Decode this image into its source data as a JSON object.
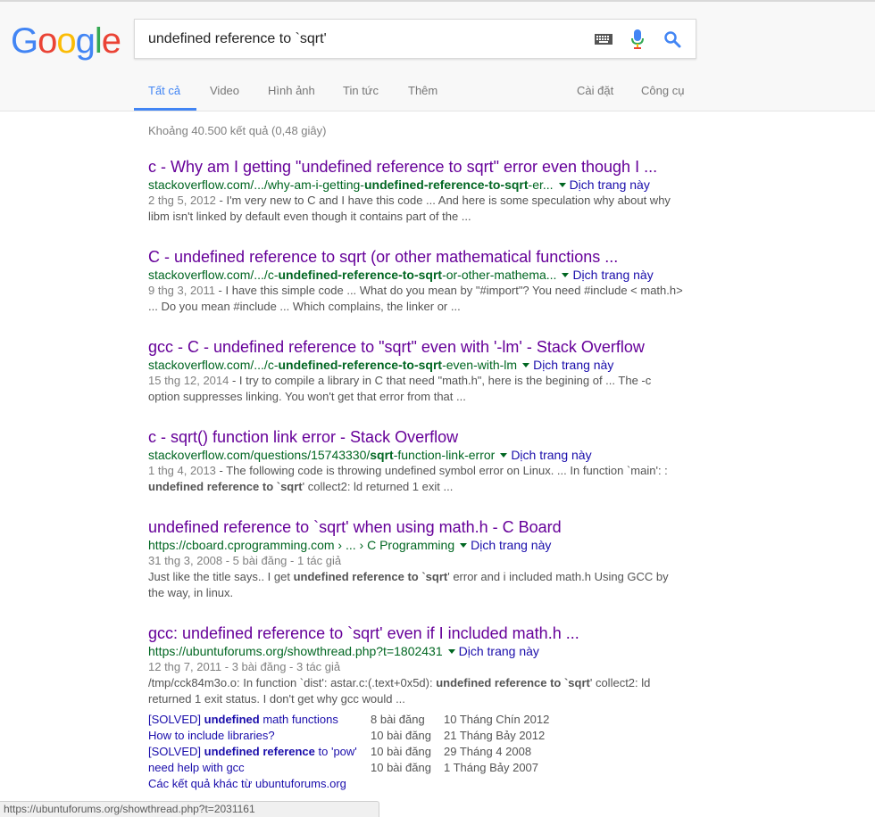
{
  "search": {
    "query": "undefined reference to `sqrt'"
  },
  "logo": {
    "letters": [
      "G",
      "o",
      "o",
      "g",
      "l",
      "e"
    ],
    "colors": [
      "#4285f4",
      "#ea4335",
      "#fbbc05",
      "#4285f4",
      "#34a853",
      "#ea4335"
    ]
  },
  "tabs": {
    "all": "Tất cả",
    "video": "Video",
    "images": "Hình ảnh",
    "news": "Tin tức",
    "more": "Thêm",
    "settings": "Cài đặt",
    "tools": "Công cụ"
  },
  "stats": "Khoảng 40.500 kết quả (0,48 giây)",
  "results": [
    {
      "title": "c - Why am I getting \"undefined reference to sqrt\" error even though I ...",
      "url_pre": "stackoverflow.com/.../why-am-i-getting-",
      "url_bold": "undefined-reference-to-sqrt",
      "url_post": "-er...",
      "translate": "Dịch trang này",
      "date": "2 thg 5, 2012",
      "snippet": " - I'm very new to C and I have this code ... And here is some speculation why about why libm isn't linked by default even though it contains part of the ..."
    },
    {
      "title": "C - undefined reference to sqrt (or other mathematical functions ...",
      "url_pre": "stackoverflow.com/.../c-",
      "url_bold": "undefined-reference-to-sqrt",
      "url_post": "-or-other-mathema...",
      "translate": "Dịch trang này",
      "date": "9 thg 3, 2011",
      "snippet": " - I have this simple code ... What do you mean by \"#import\"? You need #include < math.h> ... Do you mean #include ... Which complains, the linker or ..."
    },
    {
      "title": "gcc - C - undefined reference to \"sqrt\" even with '-lm' - Stack Overflow",
      "url_pre": "stackoverflow.com/.../c-",
      "url_bold": "undefined-reference-to-sqrt",
      "url_post": "-even-with-lm",
      "translate": "Dịch trang này",
      "date": "15 thg 12, 2014",
      "snippet": " - I try to compile a library in C that need \"math.h\", here is the begining of ... The -c option suppresses linking. You won't get that error from that ..."
    },
    {
      "title": "c - sqrt() function link error - Stack Overflow",
      "url_pre": "stackoverflow.com/questions/15743330/",
      "url_bold": "sqrt",
      "url_post": "-function-link-error",
      "translate": "Dịch trang này",
      "date": "1 thg 4, 2013",
      "snippet_pre": " - The following code is throwing undefined symbol error on Linux. ... In function `main': : ",
      "snippet_bold": "undefined reference to `sqrt",
      "snippet_post": "' collect2: ld returned 1 exit ..."
    },
    {
      "title": "undefined reference to `sqrt' when using math.h - C Board",
      "url_pre": "https://cboard.cprogramming.com › ... › C Programming",
      "translate": "Dịch trang này",
      "meta": "31 thg 3, 2008 - 5 bài đăng - 1 tác giả",
      "snippet_pre": "Just like the title says.. I get ",
      "snippet_bold": "undefined reference to `sqrt",
      "snippet_post": "' error and i included math.h Using GCC by the way, in linux."
    },
    {
      "title": "gcc: undefined reference to `sqrt' even if I included math.h ...",
      "url_pre": "https://ubuntuforums.org/showthread.php?t=1802431",
      "translate": "Dịch trang này",
      "meta": "12 thg 7, 2011 - 3 bài đăng - 3 tác giả",
      "snippet_pre": "/tmp/cck84m3o.o: In function `dist': astar.c:(.text+0x5d): ",
      "snippet_bold": "undefined reference to `sqrt",
      "snippet_post": "' collect2: ld returned 1 exit status. I don't get why gcc would ..."
    }
  ],
  "sitelinks": [
    {
      "pre": "[SOLVED] ",
      "bold": "undefined",
      "post": " math functions",
      "posts": "8 bài đăng",
      "date": "10 Tháng Chín 2012"
    },
    {
      "pre": "How to include libraries?",
      "bold": "",
      "post": "",
      "posts": "10 bài đăng",
      "date": "21 Tháng Bảy 2012"
    },
    {
      "pre": "[SOLVED] ",
      "bold": "undefined reference",
      "post": " to 'pow'",
      "posts": "10 bài đăng",
      "date": "29 Tháng 4 2008"
    },
    {
      "pre": "need help with gcc",
      "bold": "",
      "post": "",
      "posts": "10 bài đăng",
      "date": "1 Tháng Bảy 2007"
    }
  ],
  "more_results": "Các kết quả khác từ ubuntuforums.org",
  "statusbar": "https://ubuntuforums.org/showthread.php?t=2031161"
}
